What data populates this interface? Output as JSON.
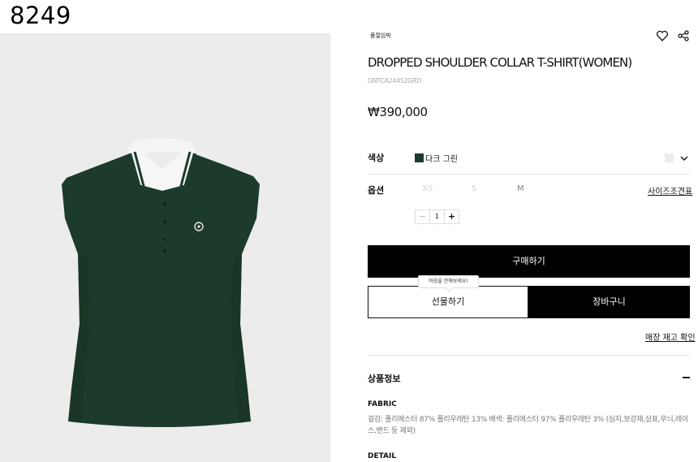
{
  "page_number": "8249",
  "product": {
    "badge": "품절임박",
    "title": "DROPPED SHOULDER COLLAR T-SHIRT(WOMEN)",
    "code": "GNTCA24452GRD",
    "price": "₩390,000"
  },
  "options": {
    "color_label": "색상",
    "color_name": "다크 그린",
    "color_hex": "#1d3b2c",
    "option_label": "옵션",
    "sizes": [
      {
        "label": "XS",
        "status": "soldout"
      },
      {
        "label": "S",
        "status": "soldout"
      },
      {
        "label": "M",
        "status": "available"
      }
    ],
    "size_guide": "사이즈조견표",
    "quantity": "1",
    "minus": "−",
    "plus": "+"
  },
  "actions": {
    "buy": "구매하기",
    "gift": "선물하기",
    "gift_tooltip": "마음을 전해보세요!",
    "cart": "장바구니",
    "store_stock": "매장 재고 확인"
  },
  "details": {
    "section_title": "상품정보",
    "fabric_heading": "FABRIC",
    "fabric_text": "겉감: 폴리에스터 87% 폴리우레탄 13% 배색: 폴리에스터 97% 폴리우레탄 3% (심지,보강재,상표,무늬,레이스,밴드 등 제외)",
    "detail_heading": "DETAIL"
  },
  "colors": {
    "image_bg": "#ececec",
    "shirt_green": "#1d3b2c",
    "button_black": "#000000"
  },
  "icons": [
    "heart-icon",
    "share-icon",
    "chevron-down-icon",
    "minus-icon"
  ]
}
